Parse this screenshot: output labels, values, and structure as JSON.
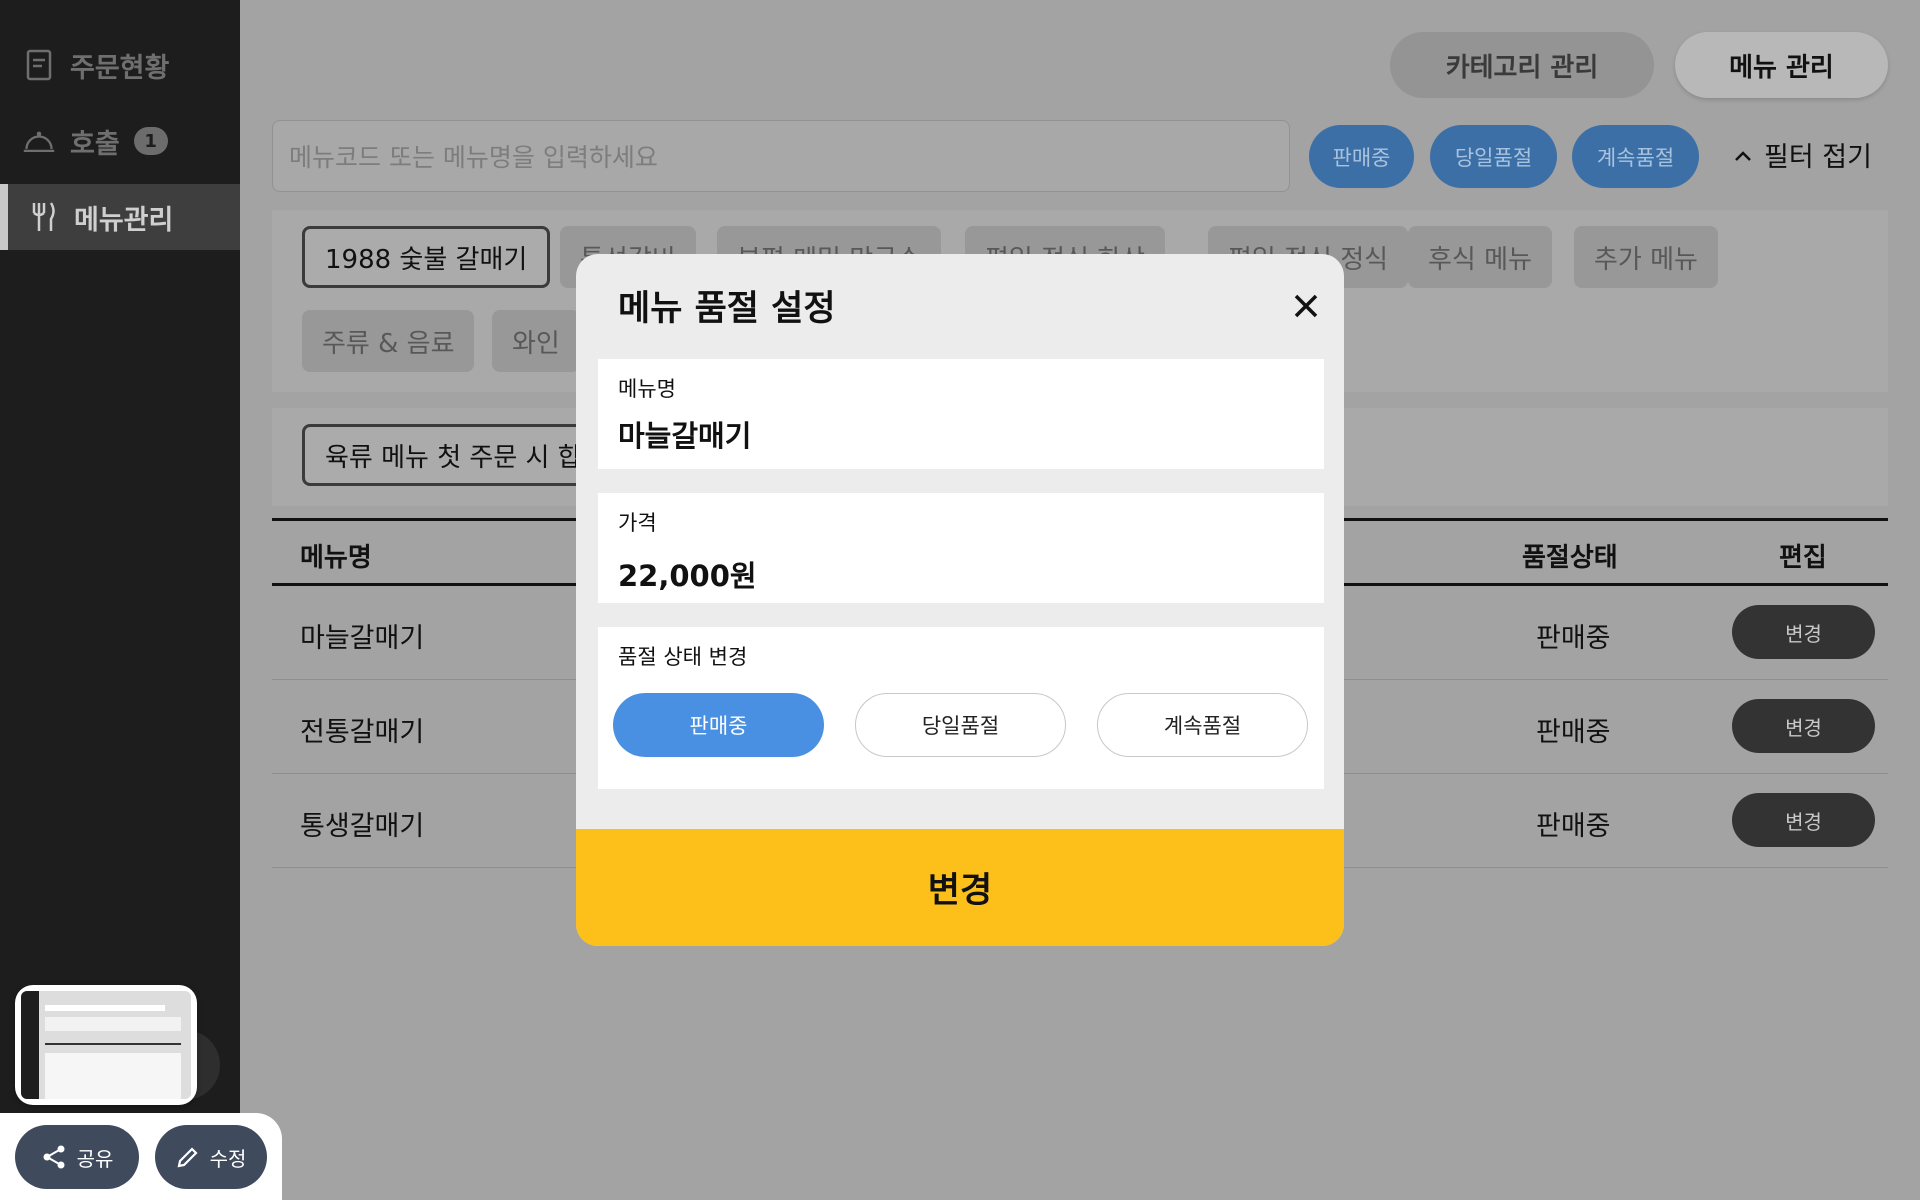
{
  "sidebar": {
    "items": [
      {
        "label": "주문현황",
        "icon": "receipt-icon"
      },
      {
        "label": "호출",
        "icon": "bell-icon",
        "badge": "1"
      },
      {
        "label": "메뉴관리",
        "icon": "utensils-icon",
        "active": true
      }
    ]
  },
  "top_tabs": {
    "category": "카테고리 관리",
    "menu": "메뉴 관리"
  },
  "search": {
    "placeholder": "메뉴코드 또는 메뉴명을 입력하세요"
  },
  "filters": {
    "selling": "판매중",
    "today_soldout": "당일품절",
    "continuous_soldout": "계속품절",
    "fold": "필터 접기"
  },
  "categories": [
    "1988 숯불 갈매기",
    "통선갈비",
    "부평 메밀 막국수",
    "평일 점심 한상",
    "평일 점심 정식",
    "후식 메뉴",
    "추가 메뉴",
    "주류 & 음료",
    "와인"
  ],
  "sub_notice": "육류 메뉴 첫 주문 시 합",
  "table": {
    "headers": {
      "name": "메뉴명",
      "status": "품절상태",
      "edit": "편집"
    },
    "rows": [
      {
        "name": "마늘갈매기",
        "status": "판매중",
        "edit": "변경"
      },
      {
        "name": "전통갈매기",
        "status": "판매중",
        "edit": "변경"
      },
      {
        "name": "통생갈매기",
        "status": "판매중",
        "edit": "변경"
      }
    ]
  },
  "modal": {
    "title": "메뉴 품절 설정",
    "name_label": "메뉴명",
    "name_value": "마늘갈매기",
    "price_label": "가격",
    "price_value": "22,000원",
    "status_label": "품절 상태 변경",
    "options": [
      "판매중",
      "당일품절",
      "계속품절"
    ],
    "selected_option": "판매중",
    "submit": "변경"
  },
  "bottom_bar": {
    "share": "공유",
    "edit": "수정"
  },
  "colors": {
    "accent_blue": "#4a90e2",
    "submit_yellow": "#fdc01a",
    "sidebar": "#1d1d1d"
  }
}
